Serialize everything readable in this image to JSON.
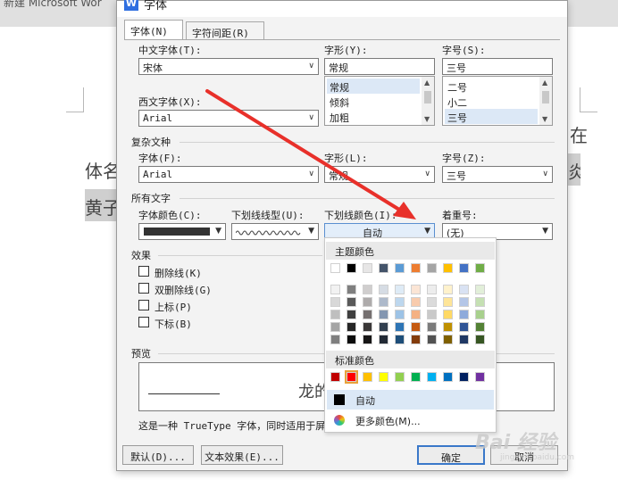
{
  "window": {
    "title_partial": "新建 Microsoft Wor"
  },
  "document": {
    "text_left_1": "体名",
    "text_left_2": "黄子",
    "text_right_1": "在",
    "text_right_2": "炎"
  },
  "dialog": {
    "title": "字体",
    "icon_label": "W",
    "tabs": [
      {
        "label": "字体(N)"
      },
      {
        "label": "字符间距(R)"
      }
    ],
    "chinese_font": {
      "label": "中文字体(T):",
      "value": "宋体"
    },
    "style": {
      "label": "字形(Y):",
      "value": "常规",
      "options": [
        "常规",
        "倾斜",
        "加粗"
      ]
    },
    "size": {
      "label": "字号(S):",
      "value": "三号",
      "options": [
        "二号",
        "小二",
        "三号"
      ]
    },
    "western_font": {
      "label": "西文字体(X):",
      "value": "Arial"
    },
    "complex": {
      "section": "复杂文种",
      "font_label": "字体(F):",
      "font_value": "Arial",
      "style_label": "字形(L):",
      "style_value": "常规",
      "size_label": "字号(Z):",
      "size_value": "三号"
    },
    "all_text": {
      "section": "所有文字",
      "color_label": "字体颜色(C):",
      "underline_type_label": "下划线线型(U):",
      "underline_color_label": "下划线颜色(I):",
      "underline_color_value": "自动",
      "emphasis_label": "着重号:",
      "emphasis_value": "(无)"
    },
    "effects": {
      "section": "效果",
      "items": [
        "删除线(K)",
        "双删除线(G)",
        "上标(P)",
        "下标(B)"
      ]
    },
    "preview": {
      "section": "预览",
      "sample": "龙的",
      "note": "这是一种 TrueType 字体，同时适用于屏"
    },
    "buttons": {
      "default": "默认(D)...",
      "text_effects": "文本效果(E)...",
      "ok": "确定",
      "cancel": "取消"
    }
  },
  "color_popup": {
    "theme_header": "主题颜色",
    "standard_header": "标准颜色",
    "auto_label": "自动",
    "more_label": "更多颜色(M)...",
    "theme_top": [
      "#ffffff",
      "#000000",
      "#e7e6e6",
      "#44546a",
      "#5b9bd5",
      "#ed7d31",
      "#a5a5a5",
      "#ffc000",
      "#4472c4",
      "#70ad47"
    ],
    "theme_shades": [
      [
        "#f2f2f2",
        "#7f7f7f",
        "#d0cece",
        "#d6dce4",
        "#deebf6",
        "#fbe5d5",
        "#ededed",
        "#fff2cc",
        "#d9e2f3",
        "#e2efd9"
      ],
      [
        "#d8d8d8",
        "#595959",
        "#aeabab",
        "#adb9ca",
        "#bdd7ee",
        "#f8cbad",
        "#dbdbdb",
        "#fee599",
        "#b4c6e7",
        "#c5e0b3"
      ],
      [
        "#bfbfbf",
        "#3f3f3f",
        "#757070",
        "#8496b0",
        "#9dc3e6",
        "#f4b183",
        "#c9c9c9",
        "#ffd965",
        "#8eaadb",
        "#a8d08d"
      ],
      [
        "#a5a5a5",
        "#262626",
        "#3a3838",
        "#323f4f",
        "#2e75b5",
        "#c55a11",
        "#7b7b7b",
        "#bf9000",
        "#2f5496",
        "#538135"
      ],
      [
        "#7f7f7f",
        "#0c0c0c",
        "#171616",
        "#222a35",
        "#1e4e79",
        "#833c0b",
        "#525252",
        "#7f6000",
        "#1f3864",
        "#375623"
      ]
    ],
    "standard": [
      "#c00000",
      "#ff0000",
      "#ffc000",
      "#ffff00",
      "#92d050",
      "#00b050",
      "#00b0f0",
      "#0070c0",
      "#002060",
      "#7030a0"
    ]
  },
  "watermark": {
    "text": "Bai 经验",
    "sub": "jingyan.baidu.com"
  }
}
